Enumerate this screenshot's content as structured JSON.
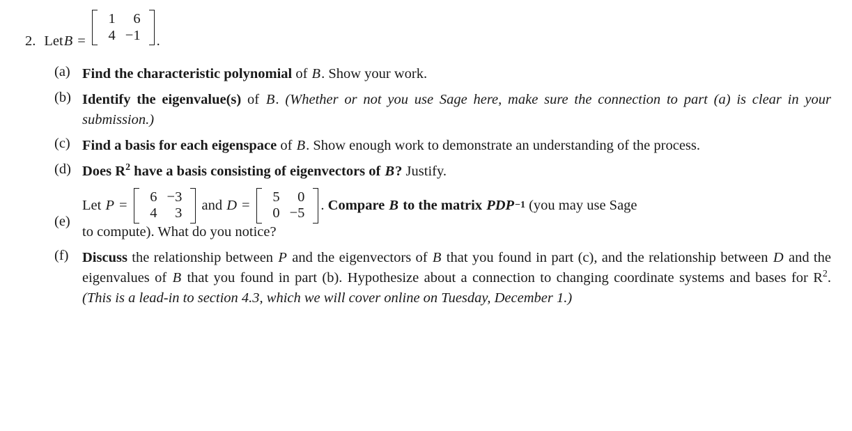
{
  "problem": {
    "number": "2.",
    "lead": "Let",
    "variable": "B",
    "equals": "=",
    "matrix_B": {
      "rows": [
        [
          "1",
          "6"
        ],
        [
          "4",
          "−1"
        ]
      ]
    },
    "period": "."
  },
  "parts": [
    {
      "label": "(a)",
      "bold_lead": "Find the characteristic polynomial",
      "text_after": " of ",
      "var": "B",
      "tail": ". Show your work."
    },
    {
      "label": "(b)",
      "bold_lead": "Identify the eigenvalue(s)",
      "text_after": " of ",
      "var": "B",
      "tail": ". ",
      "italic_note": "(Whether or not you use Sage here, make sure the connection to part (a) is clear in your submission.)"
    },
    {
      "label": "(c)",
      "bold_lead": "Find a basis for each eigenspace",
      "text_after": " of ",
      "var": "B",
      "tail": ". Show enough work to demonstrate an understanding of the process."
    },
    {
      "label": "(d)",
      "bold_lead_1": "Does ",
      "bold_blackboard": "R",
      "bold_exponent": "2",
      "bold_lead_2": " have a basis consisting of eigenvectors of ",
      "bold_var": "B",
      "bold_lead_3": "?",
      "tail": " Justify."
    },
    {
      "label": "(e)",
      "lead": "Let",
      "var_P": "P",
      "equals_1": "=",
      "matrix_P": {
        "rows": [
          [
            "6",
            "−3"
          ],
          [
            "4",
            "3"
          ]
        ]
      },
      "and": "and",
      "var_D": "D",
      "equals_2": "=",
      "matrix_D": {
        "rows": [
          [
            "5",
            "0"
          ],
          [
            "0",
            "−5"
          ]
        ]
      },
      "period": ".",
      "bold_compare": "Compare",
      "mid_var_B": "B",
      "bold_mid": "to the matrix",
      "bold_pdp": "PDP",
      "bold_pdp_exp": "−1",
      "tail": "(you may use Sage to compute). What do you notice?"
    },
    {
      "label": "(f)",
      "bold_lead": "Discuss",
      "seg_1": " the relationship between ",
      "var_P": "P",
      "seg_2": " and the eigenvectors of ",
      "var_B1": "B",
      "seg_3": " that you found in part (c), and the relationship between ",
      "var_D": "D",
      "seg_4": " and the eigenvalues of ",
      "var_B2": "B",
      "seg_5": " that you found in part (b). Hypothesize about a connection to changing coordinate systems and bases for ",
      "blackboard_R": "R",
      "blackboard_exp": "2",
      "seg_6": ". ",
      "italic_note": "(This is a lead-in to section 4.3, which we will cover online on Tuesday, December 1.)"
    }
  ],
  "colors": {
    "text": "#1a1a1a",
    "background": "#ffffff"
  }
}
